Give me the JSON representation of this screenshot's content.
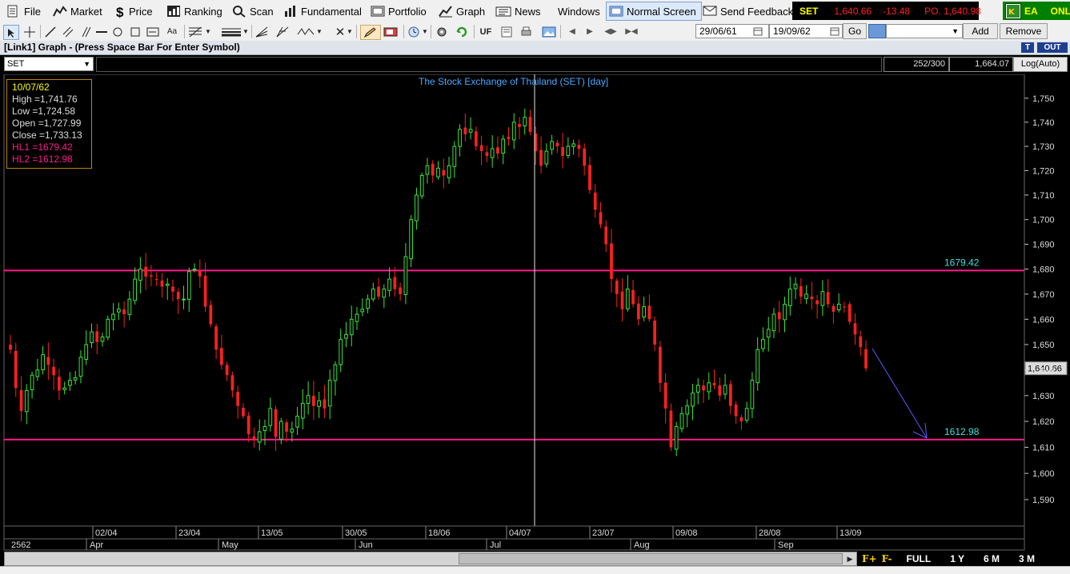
{
  "menubar": {
    "items": [
      {
        "label": "File",
        "icon": "file-icon"
      },
      {
        "label": "Market",
        "icon": "market-icon"
      },
      {
        "label": "Price",
        "icon": "dollar-icon"
      },
      {
        "label": "Ranking",
        "icon": "ranking-icon"
      },
      {
        "label": "Scan",
        "icon": "scan-icon"
      },
      {
        "label": "Fundamental",
        "icon": "fundamental-icon"
      },
      {
        "label": "Portfolio",
        "icon": "portfolio-icon"
      },
      {
        "label": "Graph",
        "icon": "graph-icon"
      },
      {
        "label": "News",
        "icon": "news-icon"
      },
      {
        "label": "Windows",
        "icon": ""
      },
      {
        "label": "Normal Screen",
        "icon": "screen-icon"
      },
      {
        "label": "Send Feedback",
        "icon": "feedback-icon"
      }
    ],
    "ticker": {
      "symbol": "SET",
      "price": "1,640.66",
      "change": "-13.48",
      "po": "PO. 1,640.98"
    },
    "status": {
      "ea": "EA",
      "online": "ONLINE"
    },
    "colors": {
      "up": "#00ff00",
      "down": "#ff2020",
      "accent": "#ffff00"
    }
  },
  "toolbar": {
    "uf_label": "UF",
    "date_from": "29/06/61",
    "date_to": "19/09/62",
    "go_label": "Go",
    "add_label": "Add",
    "remove_label": "Remove"
  },
  "window": {
    "title": "[Link1] Graph  - (Press Space Bar For Enter Symbol)",
    "t_label": "T",
    "out_label": "OUT",
    "symbol": "SET",
    "count": "252/300",
    "last": "1,664.07",
    "scale_mode": "Log(Auto)"
  },
  "chart_data": {
    "type": "candlestick",
    "title": "The Stock Exchange of Thailand (SET) [day]",
    "info_box": {
      "date": "10/07/62",
      "high": "High  =1,741.76",
      "low": "Low  =1,724.58",
      "open": "Open  =1,727.99",
      "close": "Close  =1,733.13",
      "hl1": "HL1 =1679.42",
      "hl2": "HL2 =1612.98"
    },
    "ylim": [
      1580,
      1760
    ],
    "y_ticks": [
      1590,
      1600,
      1610,
      1620,
      1630,
      1640,
      1650,
      1660,
      1670,
      1680,
      1690,
      1700,
      1710,
      1720,
      1730,
      1740,
      1750
    ],
    "y_tick_labels": [
      "1,590",
      "1,600",
      "1,610",
      "1,620",
      "1,630",
      "1,640",
      "1,650",
      "1,660",
      "1,670",
      "1,680",
      "1,690",
      "1,700",
      "1,710",
      "1,720",
      "1,730",
      "1,740",
      "1,750"
    ],
    "hlines": [
      {
        "value": 1679.42,
        "label": "1679.42",
        "color": "#ff1a8c"
      },
      {
        "value": 1612.98,
        "label": "1612.98",
        "color": "#ff1a8c"
      }
    ],
    "last_price": {
      "value": 1640.66,
      "label": "1,640.66"
    },
    "date_ticks": [
      "02/04",
      "23/04",
      "13/05",
      "30/05",
      "18/06",
      "04/07",
      "23/07",
      "09/08",
      "28/08",
      "13/09"
    ],
    "month_labels": [
      "2562",
      "Apr",
      "May",
      "Jun",
      "Jul",
      "Aug",
      "Sep"
    ],
    "crosshair_date": "10/07/62",
    "grid": true,
    "scale": "log",
    "closes": [
      1648,
      1633,
      1624,
      1632,
      1638,
      1640,
      1646,
      1642,
      1638,
      1632,
      1633,
      1636,
      1637,
      1645,
      1650,
      1655,
      1651,
      1653,
      1660,
      1662,
      1664,
      1662,
      1668,
      1676,
      1680,
      1677,
      1677,
      1676,
      1673,
      1674,
      1671,
      1668,
      1668,
      1679,
      1680,
      1677,
      1665,
      1658,
      1648,
      1642,
      1638,
      1632,
      1626,
      1622,
      1615,
      1613,
      1616,
      1618,
      1625,
      1614,
      1620,
      1616,
      1617,
      1622,
      1627,
      1630,
      1626,
      1628,
      1625,
      1636,
      1642,
      1652,
      1654,
      1660,
      1662,
      1664,
      1668,
      1672,
      1669,
      1672,
      1676,
      1672,
      1670,
      1685,
      1700,
      1710,
      1718,
      1722,
      1718,
      1721,
      1718,
      1722,
      1730,
      1737,
      1735,
      1737,
      1730,
      1728,
      1726,
      1729,
      1727,
      1733,
      1733,
      1740,
      1738,
      1742,
      1736,
      1728,
      1722,
      1728,
      1732,
      1730,
      1726,
      1730,
      1731,
      1729,
      1722,
      1712,
      1704,
      1698,
      1690,
      1676,
      1670,
      1664,
      1672,
      1666,
      1660,
      1665,
      1660,
      1650,
      1635,
      1625,
      1610,
      1618,
      1623,
      1626,
      1631,
      1634,
      1632,
      1635,
      1634,
      1630,
      1634,
      1626,
      1622,
      1620,
      1625,
      1636,
      1648,
      1652,
      1656,
      1662,
      1660,
      1666,
      1672,
      1674,
      1669,
      1670,
      1668,
      1666,
      1671,
      1666,
      1663,
      1666,
      1665,
      1659,
      1654,
      1649,
      1640.66
    ]
  },
  "periods": {
    "f_plus": "F+",
    "f_minus": "F-",
    "full": "FULL",
    "y1": "1 Y",
    "m6": "6 M",
    "m3": "3 M"
  }
}
